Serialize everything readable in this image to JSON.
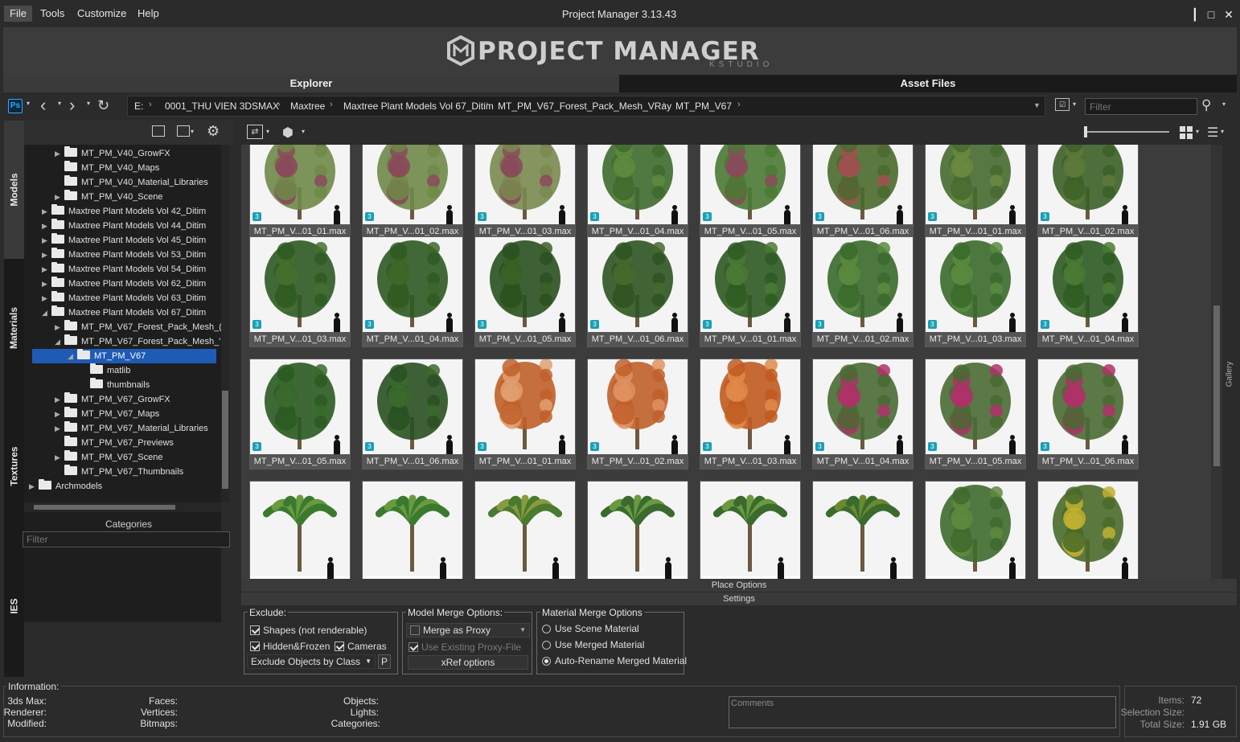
{
  "menu": {
    "items": [
      "File",
      "Tools",
      "Customize",
      "Help"
    ]
  },
  "window": {
    "title": "Project Manager 3.13.43"
  },
  "banner": {
    "logo": "PROJECT MANAGER",
    "logo_sub": "KSTUDIO"
  },
  "tabs": [
    "Explorer",
    "Asset Files"
  ],
  "address": {
    "crumbs": [
      "E:",
      "0001_THU VIEN 3DSMAX",
      "Maxtree",
      "Maxtree Plant Models Vol 67_Ditim",
      "MT_PM_V67_Forest_Pack_Mesh_VRay",
      "MT_PM_V67"
    ],
    "filter_placeholder": "Filter"
  },
  "side_tabs": [
    "Models",
    "Materials",
    "Textures",
    "IES"
  ],
  "tree": {
    "nodes": [
      {
        "label": "MT_PM_V40_GrowFX",
        "arrow": "▶"
      },
      {
        "label": "MT_PM_V40_Maps",
        "arrow": ""
      },
      {
        "label": "MT_PM_V40_Material_Libraries",
        "arrow": ""
      },
      {
        "label": "MT_PM_V40_Scene",
        "arrow": "▶"
      },
      {
        "label": "Maxtree Plant Models Vol 42_Ditim",
        "arrow": "▶"
      },
      {
        "label": "Maxtree Plant Models Vol 44_Ditim",
        "arrow": "▶"
      },
      {
        "label": "Maxtree Plant Models Vol 45_Ditim",
        "arrow": "▶"
      },
      {
        "label": "Maxtree Plant Models Vol 53_Ditim",
        "arrow": "▶"
      },
      {
        "label": "Maxtree Plant Models Vol 54_Ditim",
        "arrow": "▶"
      },
      {
        "label": "Maxtree Plant Models Vol 62_Ditim",
        "arrow": "▶"
      },
      {
        "label": "Maxtree Plant Models Vol 63_Ditim",
        "arrow": "▶"
      },
      {
        "label": "Maxtree Plant Models Vol 67_Ditim",
        "arrow": "◢"
      },
      {
        "label": "MT_PM_V67_Forest_Pack_Mesh_(",
        "arrow": "▶"
      },
      {
        "label": "MT_PM_V67_Forest_Pack_Mesh_'",
        "arrow": "◢"
      },
      {
        "label": "MT_PM_V67",
        "arrow": "◢"
      },
      {
        "label": "matlib",
        "arrow": ""
      },
      {
        "label": "thumbnails",
        "arrow": ""
      },
      {
        "label": "MT_PM_V67_GrowFX",
        "arrow": "▶"
      },
      {
        "label": "MT_PM_V67_Maps",
        "arrow": "▶"
      },
      {
        "label": "MT_PM_V67_Material_Libraries",
        "arrow": "▶"
      },
      {
        "label": "MT_PM_V67_Previews",
        "arrow": ""
      },
      {
        "label": "MT_PM_V67_Scene",
        "arrow": "▶"
      },
      {
        "label": "MT_PM_V67_Thumbnails",
        "arrow": ""
      },
      {
        "label": "Archmodels",
        "arrow": "▶"
      }
    ]
  },
  "categories": {
    "label": "Categories",
    "filter_placeholder": "Filter"
  },
  "gallery": {
    "badge": "3",
    "items": [
      "MT_PM_V...01_01.max",
      "MT_PM_V...01_02.max",
      "MT_PM_V...01_03.max",
      "MT_PM_V...01_04.max",
      "MT_PM_V...01_05.max",
      "MT_PM_V...01_06.max",
      "MT_PM_V...01_01.max",
      "MT_PM_V...01_02.max",
      "MT_PM_V...01_03.max",
      "MT_PM_V...01_04.max",
      "MT_PM_V...01_05.max",
      "MT_PM_V...01_06.max",
      "MT_PM_V...01_01.max",
      "MT_PM_V...01_02.max",
      "MT_PM_V...01_03.max",
      "MT_PM_V...01_04.max",
      "MT_PM_V...01_05.max",
      "MT_PM_V...01_06.max",
      "MT_PM_V...01_01.max",
      "MT_PM_V...01_02.max",
      "MT_PM_V...01_03.max",
      "MT_PM_V...01_04.max",
      "MT_PM_V...01_05.max",
      "MT_PM_V...01_06.max",
      "",
      "",
      "",
      "",
      "",
      "",
      "",
      ""
    ],
    "side_label": "Gallery"
  },
  "options": {
    "place_options": "Place Options",
    "settings": "Settings"
  },
  "exclude": {
    "title": "Exclude:",
    "shapes": "Shapes (not renderable)",
    "hidden": "Hidden&Frozen",
    "cameras": "Cameras",
    "by_class": "Exclude Objects by Class",
    "p_button": "P"
  },
  "model_merge": {
    "title": "Model Merge Options:",
    "merge_proxy": "Merge as Proxy",
    "use_proxy": "Use Existing Proxy-File",
    "xref": "xRef options"
  },
  "material_merge": {
    "title": "Material  Merge Options",
    "scene": "Use Scene Material",
    "merged": "Use Merged Material",
    "auto": "Auto-Rename Merged Material"
  },
  "info": {
    "title": "Information:",
    "max": "3ds Max:",
    "renderer": "Renderer:",
    "modified": "Modified:",
    "faces": "Faces:",
    "vertices": "Vertices:",
    "bitmaps": "Bitmaps:",
    "objects": "Objects:",
    "lights": "Lights:",
    "categories": "Categories:",
    "comments": "Comments"
  },
  "stats": {
    "items_label": "Items:",
    "items_value": "72",
    "selection_label": "Selection Size:",
    "selection_value": "",
    "total_label": "Total Size:",
    "total_value": "1.91 GB"
  },
  "colors": {
    "selected": "#1e5bb5",
    "badge": "#1aa0b5",
    "panel": "#2b2b2b",
    "tabbar": "#1a1a1a"
  }
}
